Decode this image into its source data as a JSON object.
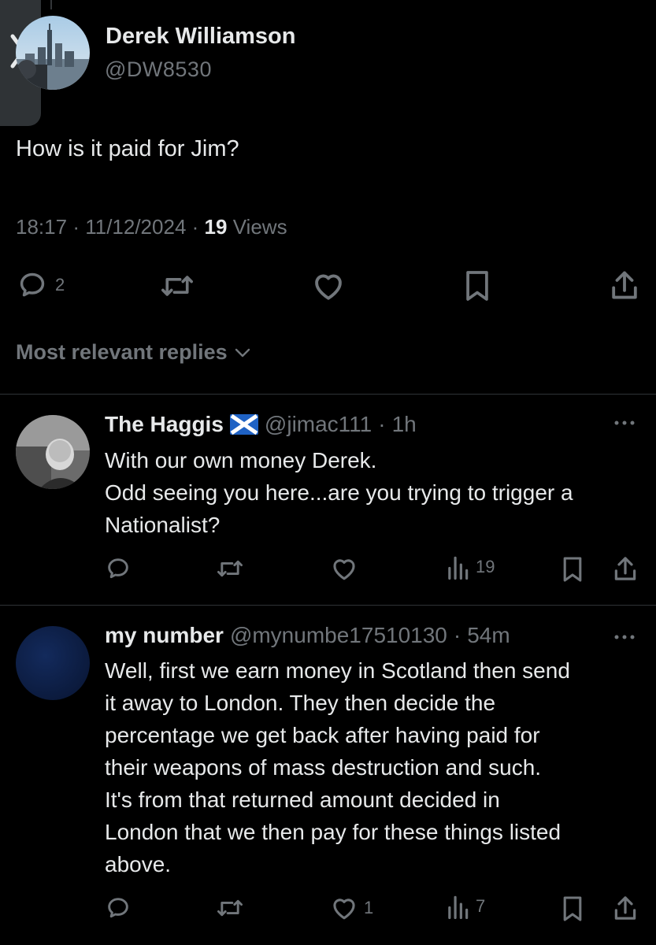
{
  "main_post": {
    "name": "Derek Williamson",
    "handle": "@DW8530",
    "text": "How is it paid for Jim?",
    "time": "18:17",
    "date": "11/12/2024",
    "views_count": "19",
    "views_label": "Views",
    "replies_count": "2"
  },
  "section_label": "Most relevant replies",
  "replies": [
    {
      "name": "The Haggis",
      "handle": "@jimac111",
      "time": "1h",
      "line1": "With our own money Derek.",
      "line2": "Odd seeing you here...are you trying to trigger a",
      "line3": "Nationalist?",
      "views": "19"
    },
    {
      "name": "my number",
      "handle": "@mynumbe17510130",
      "time": "54m",
      "line1": "Well, first we earn money in Scotland then send",
      "line2": "it away to London. They then decide the",
      "line3": "percentage we get back after having paid for",
      "line4": "their weapons of mass destruction and such.",
      "line5": "It's from that returned amount decided in",
      "line6": "London that we then pay for these things listed",
      "line7": "above.",
      "likes": "1",
      "views": "7"
    }
  ],
  "colors": {
    "background": "#000000",
    "text": "#e7e9ea",
    "muted": "#71767b",
    "divider": "#2f3336"
  },
  "icons": [
    "chevron-right-icon",
    "reply-icon",
    "retweet-icon",
    "like-icon",
    "bookmark-icon",
    "share-icon",
    "views-icon",
    "more-icon",
    "chevron-down-icon",
    "scotland-flag-icon"
  ]
}
